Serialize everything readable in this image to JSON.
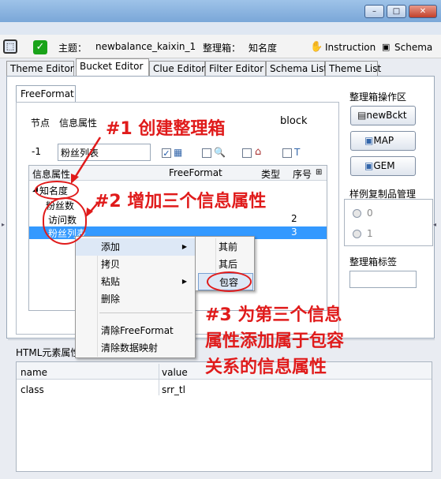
{
  "toolbar": {
    "theme_label": "主题：",
    "theme_value": "newbalance_kaixin_1",
    "box_label": "整理箱：",
    "box_value": "知名度",
    "instruction": "Instruction",
    "schema": "Schema"
  },
  "tabs": [
    "Theme Editor",
    "Bucket Editor",
    "Clue Editor",
    "Filter Editor",
    "Schema List",
    "Theme List"
  ],
  "subtab": "FreeFormat",
  "row1": {
    "node": "节点",
    "info": "信息属性",
    "block": "block"
  },
  "row2": {
    "num": "-1",
    "input": "粉丝列表"
  },
  "table": {
    "headers": [
      "信息属性",
      "FreeFormat",
      "类型",
      "序号"
    ],
    "rows": [
      {
        "name": "知名度",
        "seq": ""
      },
      {
        "name": "粉丝数",
        "seq": ""
      },
      {
        "name": "访问数",
        "seq": "2"
      },
      {
        "name": "粉丝列表",
        "seq": "3"
      }
    ]
  },
  "right": {
    "ops_title": "整理箱操作区",
    "btn1": "newBckt",
    "btn2": "MAP",
    "btn3": "GEM",
    "sample_title": "样例复制品管理",
    "r0": "0",
    "r1": "1",
    "tag_title": "整理箱标签"
  },
  "html_panel": {
    "title": "HTML元素属性",
    "col1": "name",
    "col2": "value",
    "row_name": "class",
    "row_value": "srr_tl"
  },
  "menu": {
    "add": "添加",
    "copy": "拷贝",
    "paste": "粘贴",
    "delete": "删除",
    "clear_ff": "清除FreeFormat",
    "clear_map": "清除数据映射"
  },
  "submenu": {
    "before": "其前",
    "after": "其后",
    "contain": "包容"
  },
  "annotations": {
    "a1": "#1  创建整理箱",
    "a2": "#2  增加三个信息属性",
    "a3_l1": "#3  为第三个信息",
    "a3_l2": "属性添加属于包容",
    "a3_l3": "关系的信息属性"
  }
}
